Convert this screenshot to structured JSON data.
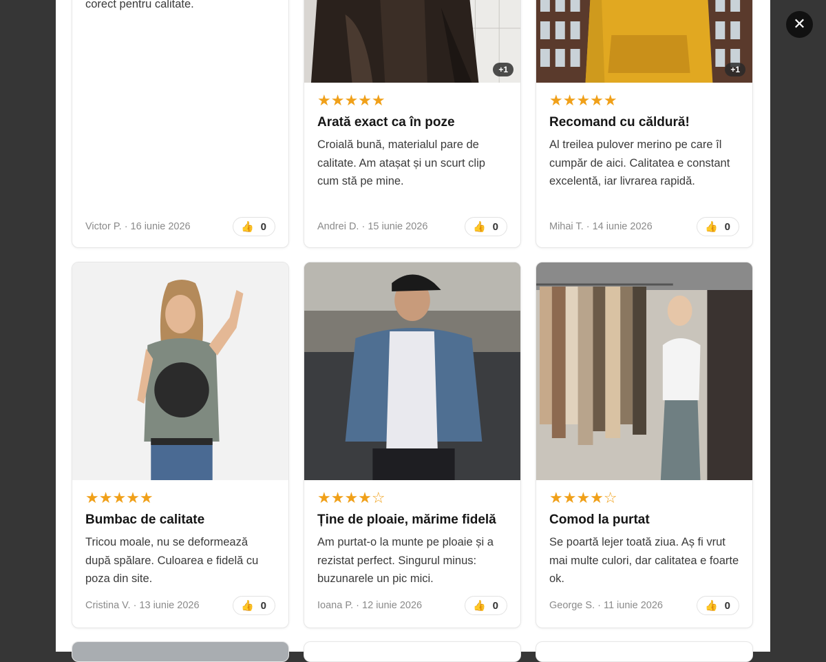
{
  "close_label": "✕",
  "colors": {
    "star": "#f0a019",
    "backdrop": "#363636"
  },
  "icons": {
    "thumbs_up": "👍",
    "close": "close-icon"
  },
  "reviews": [
    {
      "text": "corect pentru calitate.",
      "meta": "Victor P. · 16 iunie 2026",
      "helpful": "0"
    },
    {
      "stars": "★★★★★",
      "rating": 5,
      "title": "Arată exact ca în poze",
      "text": "Croială bună, materialul pare de calitate. Am atașat și un scurt clip cum stă pe mine.",
      "meta": "Andrei D. · 15 iunie 2026",
      "helpful": "0",
      "more_media": "+1"
    },
    {
      "stars": "★★★★★",
      "rating": 5,
      "title": "Recomand cu căldură!",
      "text": "Al treilea pulover merino pe care îl cumpăr de aici. Calitatea e constant excelentă, iar livrarea rapidă.",
      "meta": "Mihai T. · 14 iunie 2026",
      "helpful": "0",
      "more_media": "+1"
    },
    {
      "stars": "★★★★★",
      "rating": 5,
      "title": "Bumbac de calitate",
      "text": "Tricou moale, nu se deformează după spălare. Culoarea e fidelă cu poza din site.",
      "meta": "Cristina V. · 13 iunie 2026",
      "helpful": "0"
    },
    {
      "stars": "★★★★☆",
      "rating": 4,
      "title": "Ține de ploaie, mărime fidelă",
      "text": "Am purtat-o la munte pe ploaie și a rezistat perfect. Singurul minus: buzunarele un pic mici.",
      "meta": "Ioana P. · 12 iunie 2026",
      "helpful": "0"
    },
    {
      "stars": "★★★★☆",
      "rating": 4,
      "title": "Comod la purtat",
      "text": "Se poartă lejer toată ziua. Aș fi vrut mai multe culori, dar calitatea e foarte ok.",
      "meta": "George S. · 11 iunie 2026",
      "helpful": "0"
    }
  ]
}
